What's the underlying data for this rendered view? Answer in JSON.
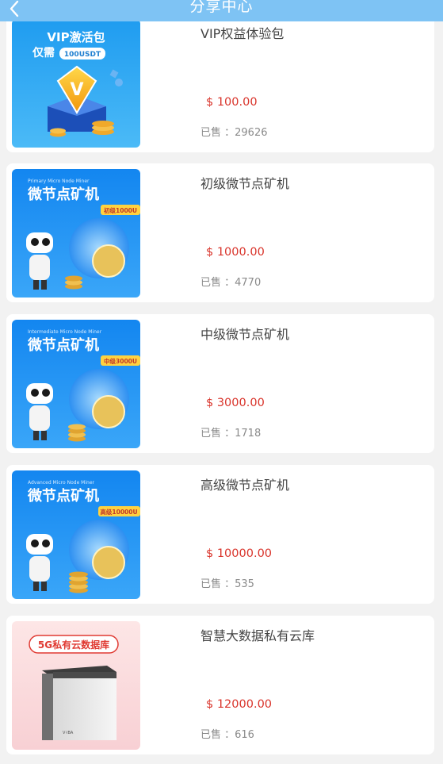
{
  "header": {
    "title": "分享中心",
    "back_icon": "chevron-left-icon"
  },
  "colors": {
    "header_bg": "#7ec3f4",
    "price": "#d9342b",
    "card_bg": "#ffffff",
    "page_bg": "#f2f2f2"
  },
  "products": [
    {
      "name": "VIP权益体验包",
      "price": "$ 100.00",
      "sold_label": "已售 ：",
      "sold_count": "29626",
      "thumb": {
        "line1": "VIP激活包",
        "line2": "仅需",
        "badge": "100USDT"
      }
    },
    {
      "name": "初级微节点矿机",
      "price": "$ 1000.00",
      "sold_label": "已售 ：",
      "sold_count": "4770",
      "thumb": {
        "subtitle": "Primary Micro Node Miner",
        "title": "微节点矿机",
        "tag": "初级1000U"
      }
    },
    {
      "name": "中级微节点矿机",
      "price": "$ 3000.00",
      "sold_label": "已售 ：",
      "sold_count": "1718",
      "thumb": {
        "subtitle": "Intermediate Micro Node Miner",
        "title": "微节点矿机",
        "tag": "中级3000U"
      }
    },
    {
      "name": "高级微节点矿机",
      "price": "$ 10000.00",
      "sold_label": "已售 ：",
      "sold_count": "535",
      "thumb": {
        "subtitle": "Advanced Micro Node Miner",
        "title": "微节点矿机",
        "tag": "高级10000U"
      }
    },
    {
      "name": "智慧大数据私有云库",
      "price": "$ 12000.00",
      "sold_label": "已售 ：",
      "sold_count": "616",
      "thumb": {
        "title": "5G私有云数据库"
      }
    }
  ]
}
